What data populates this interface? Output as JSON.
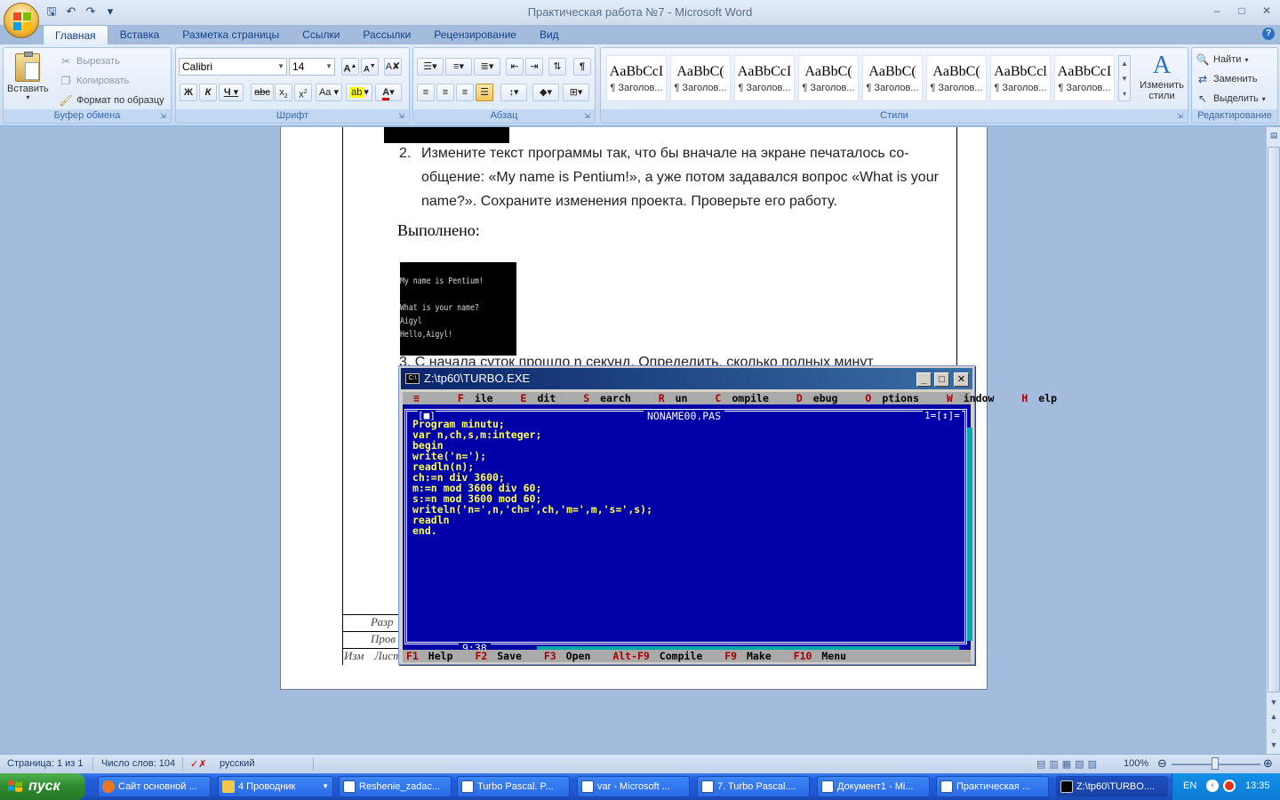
{
  "window": {
    "title": "Практическая работа №7 - Microsoft Word"
  },
  "tabs": [
    {
      "label": "Главная"
    },
    {
      "label": "Вставка"
    },
    {
      "label": "Разметка страницы"
    },
    {
      "label": "Ссылки"
    },
    {
      "label": "Рассылки"
    },
    {
      "label": "Рецензирование"
    },
    {
      "label": "Вид"
    }
  ],
  "ribbon": {
    "clipboard": {
      "label": "Буфер обмена",
      "paste": "Вставить",
      "cut": "Вырезать",
      "copy": "Копировать",
      "format_painter": "Формат по образцу"
    },
    "font": {
      "label": "Шрифт",
      "font_name": "Calibri",
      "font_size": "14"
    },
    "paragraph": {
      "label": "Абзац"
    },
    "styles": {
      "label": "Стили",
      "items": [
        {
          "sample": "AaBbCcI",
          "name": "¶ Заголов..."
        },
        {
          "sample": "AaBbC(",
          "name": "¶ Заголов..."
        },
        {
          "sample": "AaBbCcI",
          "name": "¶ Заголов..."
        },
        {
          "sample": "AaBbC(",
          "name": "¶ Заголов..."
        },
        {
          "sample": "AaBbC(",
          "name": "¶ Заголов..."
        },
        {
          "sample": "AaBbC(",
          "name": "¶ Заголов..."
        },
        {
          "sample": "AaBbCcl",
          "name": "¶ Заголов..."
        },
        {
          "sample": "AaBbCcI",
          "name": "¶ Заголов..."
        }
      ],
      "change_styles": "Изменить стили"
    },
    "editing": {
      "label": "Редактирование",
      "find": "Найти",
      "replace": "Заменить",
      "select": "Выделить"
    }
  },
  "document": {
    "item2_number": "2.",
    "item2_text": "Измените текст программы так, что бы вначале на экране печаталось со-общение: «My name is Pentium!», а уже потом задавался вопрос «What is your name?». Сохраните изменения проекта. Проверьте его работу.",
    "done_label": "Выполнено:",
    "console_lines": [
      "My name is Pentium!",
      "",
      "What is your name?",
      "Aigyl",
      "Hello,Aigyl!"
    ],
    "item3_text": "3.   С начала суток прошло n секунд. Определить, сколько полных минут",
    "stamp": [
      "Разр",
      "Пров",
      "Изм",
      "Лист"
    ]
  },
  "turbo": {
    "title": "Z:\\tp60\\TURBO.EXE",
    "menu": [
      {
        "hot": "≡",
        "rest": ""
      },
      {
        "hot": "F",
        "rest": "ile"
      },
      {
        "hot": "E",
        "rest": "dit"
      },
      {
        "hot": "S",
        "rest": "earch"
      },
      {
        "hot": "R",
        "rest": "un"
      },
      {
        "hot": "C",
        "rest": "ompile"
      },
      {
        "hot": "D",
        "rest": "ebug"
      },
      {
        "hot": "O",
        "rest": "ptions"
      },
      {
        "hot": "W",
        "rest": "indow"
      },
      {
        "hot": "H",
        "rest": "elp"
      }
    ],
    "file_name": "NONAME00.PAS",
    "window_number": "1=[↕]=",
    "close_box": "[■]",
    "code": "Program minutu;\nvar n,ch,s,m:integer;\nbegin\nwrite('n=');\nreadln(n);\nch:=n div 3600;\nm:=n mod 3600 div 60;\ns:=n mod 3600 mod 60;\nwriteln('n=',n,'ch=',ch,'m=',m,'s=',s);\nreadln\nend.",
    "cursor_pos": "9:38",
    "status": [
      {
        "key": "F1",
        "label": "Help"
      },
      {
        "key": "F2",
        "label": "Save"
      },
      {
        "key": "F3",
        "label": "Open"
      },
      {
        "key": "Alt-F9",
        "label": "Compile"
      },
      {
        "key": "F9",
        "label": "Make"
      },
      {
        "key": "F10",
        "label": "Menu"
      }
    ]
  },
  "statusbar": {
    "page": "Страница: 1 из 1",
    "words": "Число слов: 104",
    "language": "русский",
    "zoom": "100%"
  },
  "taskbar": {
    "start": "пуск",
    "tasks": [
      {
        "label": "Сайт основной ...",
        "color": "#e87722"
      },
      {
        "label": "4 Проводник",
        "color": "#f2c94c"
      },
      {
        "label": "Reshenie_zadac...",
        "color": "#2b5797"
      },
      {
        "label": "Turbo Pascal. P...",
        "color": "#2b5797"
      },
      {
        "label": "var - Microsoft ...",
        "color": "#2b5797"
      },
      {
        "label": "7. Turbo Pascal....",
        "color": "#2b5797"
      },
      {
        "label": "Документ1 - Mi...",
        "color": "#2b5797"
      },
      {
        "label": "Практическая ...",
        "color": "#2b5797"
      },
      {
        "label": "Z:\\tp60\\TURBO....",
        "color": "#000000"
      }
    ],
    "lang": "EN",
    "time": "13:35"
  }
}
